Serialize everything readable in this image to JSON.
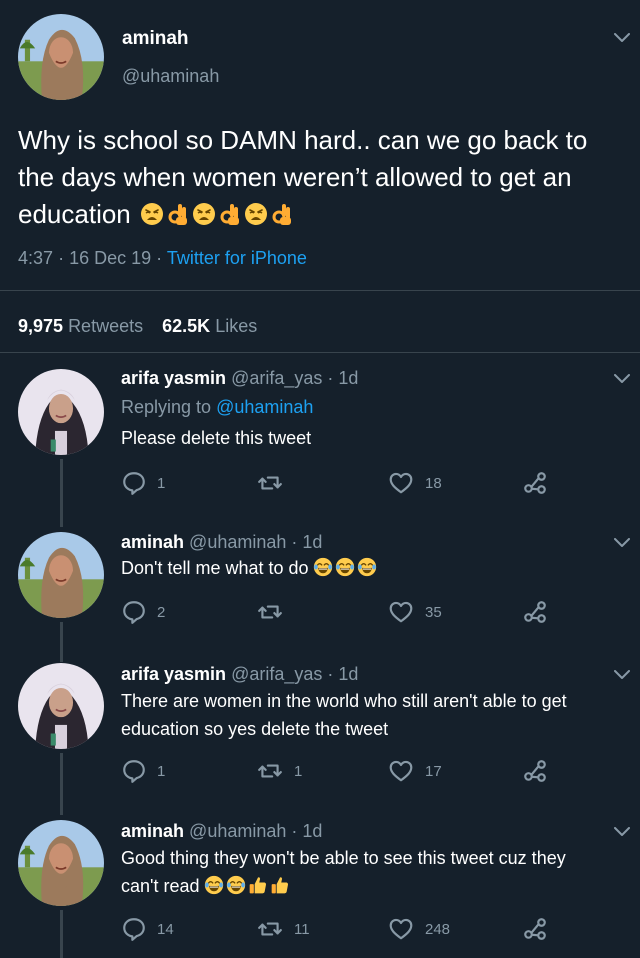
{
  "main_tweet": {
    "display_name": "aminah",
    "handle": "@uhaminah",
    "text": "Why is school so DAMN hard.. can we go back to the days when women weren’t allowed to get an education",
    "text_emoji": [
      "weary-face",
      "ok-hand",
      "weary-face",
      "ok-hand",
      "weary-face",
      "ok-hand"
    ],
    "time": "4:37",
    "date": "16 Dec 19",
    "source": "Twitter for iPhone",
    "sep1": "·",
    "sep2": "·",
    "retweets_count": "9,975",
    "retweets_label": "Retweets",
    "likes_count": "62.5K",
    "likes_label": "Likes"
  },
  "replies": [
    {
      "name": "arifa yasmin",
      "handle": "@arifa_yas",
      "age": "· 1d",
      "replying_label": "Replying to",
      "replying_to": "@uhaminah",
      "text": "Please delete this tweet",
      "reply_count": "1",
      "retweet_count": "",
      "like_count": "18"
    },
    {
      "name": "aminah",
      "handle": "@uhaminah",
      "age": "· 1d",
      "text": "Don't tell me what to do",
      "text_emoji": [
        "tears-of-joy",
        "tears-of-joy",
        "tears-of-joy"
      ],
      "reply_count": "2",
      "retweet_count": "",
      "like_count": "35"
    },
    {
      "name": "arifa yasmin",
      "handle": "@arifa_yas",
      "age": "· 1d",
      "text_line1": "There are women in the world who still aren't able to get",
      "text_line2": "education so yes delete the tweet",
      "reply_count": "1",
      "retweet_count": "1",
      "like_count": "17"
    },
    {
      "name": "aminah",
      "handle": "@uhaminah",
      "age": "· 1d",
      "text_line1": "Good thing they won't be able to see this tweet cuz they",
      "text_line2": "can't read",
      "text_emoji": [
        "tears-of-joy",
        "tears-of-joy",
        "thumbs-up",
        "thumbs-up"
      ],
      "reply_count": "14",
      "retweet_count": "11",
      "like_count": "248"
    }
  ],
  "colors": {
    "background": "#15202b",
    "text": "#ffffff",
    "muted": "#8899a6",
    "link": "#1da1f2",
    "divider": "#38444d"
  }
}
